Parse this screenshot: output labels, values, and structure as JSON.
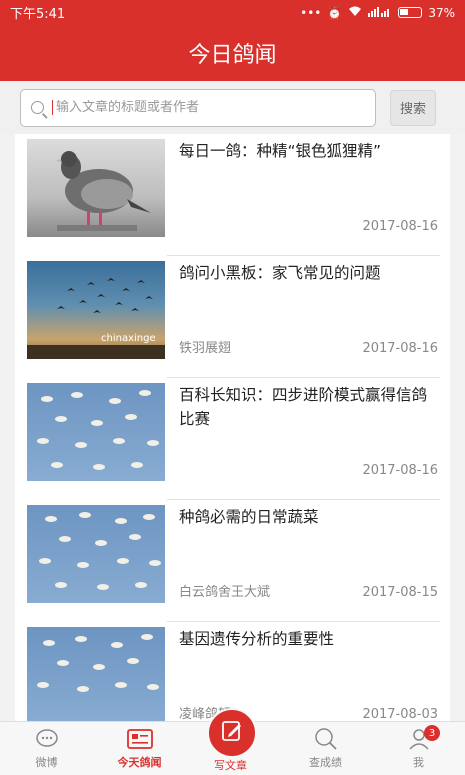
{
  "status_bar": {
    "time": "下午5:41",
    "battery": "37%",
    "network": "4G"
  },
  "header": {
    "title": "今日鸽闻"
  },
  "search": {
    "placeholder": "输入文章的标题或者作者",
    "button_label": "搜索"
  },
  "articles": [
    {
      "title": "每日一鸽：种精“银色狐狸精”",
      "source": "",
      "date": "2017-08-16",
      "thumb": "pigeon"
    },
    {
      "title": "鸽问小黑板：家飞常见的问题",
      "source": "铁羽展翅",
      "date": "2017-08-16",
      "thumb": "sunset",
      "watermark": "chinaxinge"
    },
    {
      "title": "百科长知识：四步进阶模式赢得信鸽比赛",
      "source": "",
      "date": "2017-08-16",
      "thumb": "flock"
    },
    {
      "title": "种鸽必需的日常蔬菜",
      "source": "白云鸽舍王大斌",
      "date": "2017-08-15",
      "thumb": "flock"
    },
    {
      "title": "基因遗传分析的重要性",
      "source": "凌峰鸽轩",
      "date": "2017-08-03",
      "thumb": "flock"
    }
  ],
  "tabs": [
    {
      "label": "微博",
      "icon": "chat-bubble-icon"
    },
    {
      "label": "今天鸽闻",
      "icon": "newspaper-icon",
      "active": true
    },
    {
      "label": "写文章",
      "icon": "edit-icon"
    },
    {
      "label": "查成绩",
      "icon": "search-icon"
    },
    {
      "label": "我",
      "icon": "person-icon",
      "badge": "3"
    }
  ],
  "colors": {
    "brand": "#d9302c"
  }
}
